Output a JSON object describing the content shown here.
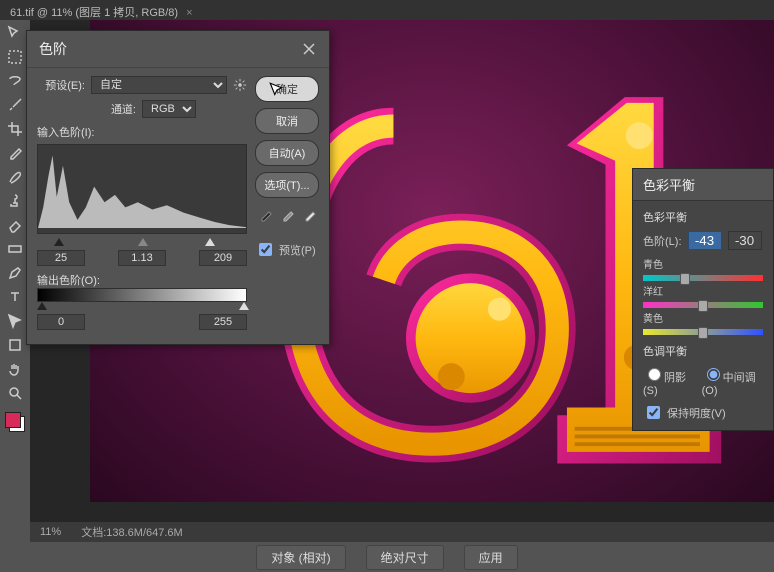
{
  "tab": {
    "title": "61.tif @ 11% (图层 1 拷贝, RGB/8)"
  },
  "status": {
    "zoom": "11%",
    "docinfo": "文档:138.6M/647.6M"
  },
  "bottom": {
    "b1": "对象 (相对)",
    "b2": "绝对尺寸",
    "b3": "应用"
  },
  "levels": {
    "title": "色阶",
    "preset_label": "预设(E):",
    "preset_value": "自定",
    "channel_label": "通道:",
    "channel_value": "RGB",
    "input_label": "输入色阶(I):",
    "in_black": "25",
    "in_gamma": "1.13",
    "in_white": "209",
    "output_label": "输出色阶(O):",
    "out_black": "0",
    "out_white": "255",
    "ok": "确定",
    "cancel": "取消",
    "auto": "自动(A)",
    "options": "选项(T)...",
    "preview": "预览(P)"
  },
  "cb": {
    "title": "色彩平衡",
    "section": "色彩平衡",
    "levels_label": "色阶(L):",
    "v1": "-43",
    "v2": "-30",
    "s1": "青色",
    "s2": "洋红",
    "s3": "黄色",
    "tone_section": "色调平衡",
    "shadows": "阴影(S)",
    "midtones": "中间调(O)",
    "preserve": "保持明度(V)"
  }
}
